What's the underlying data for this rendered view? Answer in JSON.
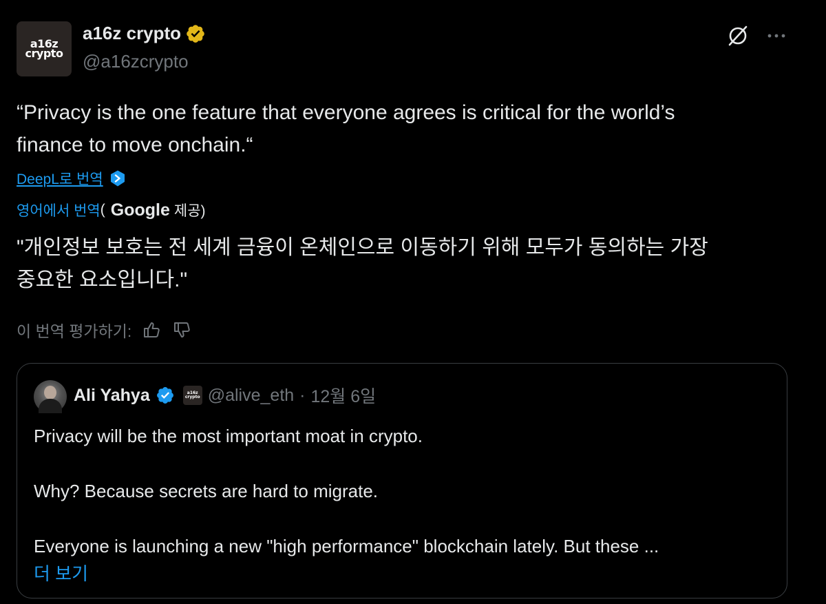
{
  "author": {
    "avatar_line1": "a16z",
    "avatar_line2": "crypto",
    "display_name": "a16z crypto",
    "handle": "@a16zcrypto",
    "verified_color": "#e2b719"
  },
  "header_icons": [
    "grok-icon",
    "more-icon"
  ],
  "tweet": {
    "text_line1": "“Privacy is the one feature that everyone agrees is critical for the world’s",
    "text_line2": "finance to move onchain.“"
  },
  "translation": {
    "deepl_label": "DeepL로 번역",
    "google_prefix": "영어에서 번역",
    "google_open": "(",
    "google_word": "Google",
    "google_suffix": "제공)",
    "text_line1": "\"개인정보 보호는 전 세계 금융이 온체인으로 이동하기 위해 모두가 동의하는 가장",
    "text_line2": "중요한 요소입니다.\"",
    "rate_label": "이 번역 평가하기:"
  },
  "quote": {
    "name": "Ali Yahya",
    "badge_line1": "a16z",
    "badge_line2": "crypto",
    "handle": "@alive_eth",
    "dot": "·",
    "date": "12월 6일",
    "para1": "Privacy will be the most important moat in crypto.",
    "para2": "Why? Because secrets are hard to migrate.",
    "para3": "Everyone is launching a new \"high performance\" blockchain lately. But these ...",
    "more": "더 보기"
  },
  "colors": {
    "background": "#000000",
    "text": "#e7e9ea",
    "muted": "#71767b",
    "link": "#1d9bf0",
    "border": "#3a3e42"
  }
}
